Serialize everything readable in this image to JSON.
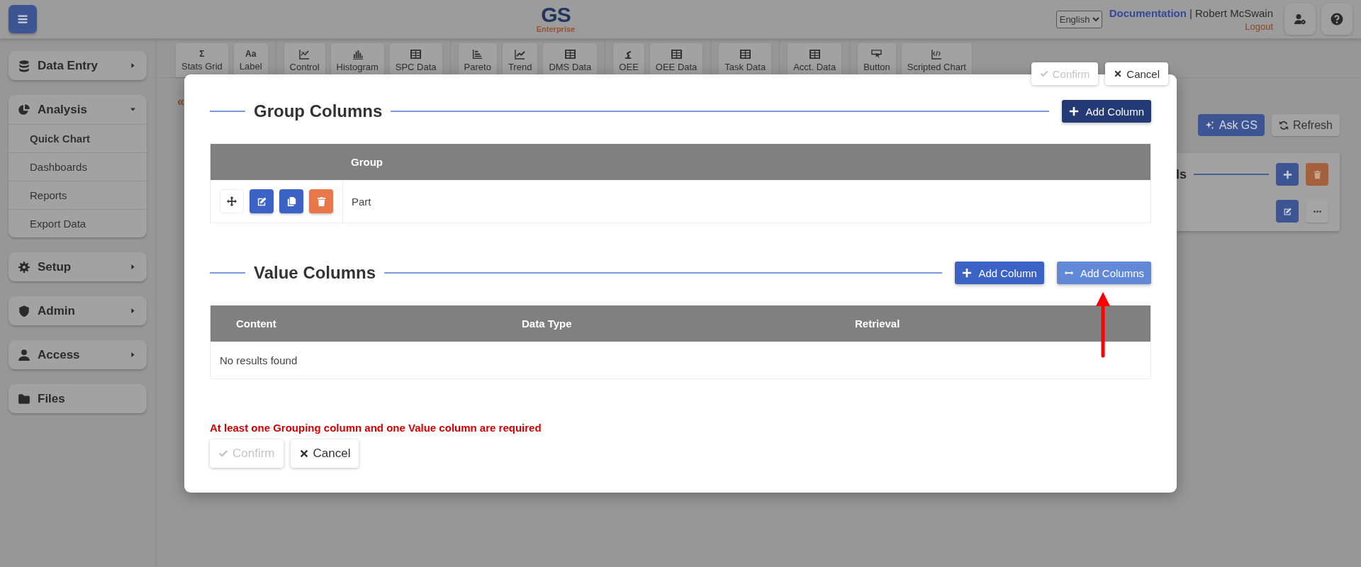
{
  "header": {
    "logo": {
      "title": "GS",
      "subtitle": "Enterprise"
    },
    "language": "English",
    "documentation_link": "Documentation",
    "user_name": "| Robert McSwain",
    "logout_link": "Logout"
  },
  "sidebar": [
    {
      "label": "Data Entry",
      "expanded": false
    },
    {
      "label": "Analysis",
      "expanded": true,
      "children": [
        {
          "label": "Quick Chart",
          "selected": true
        },
        {
          "label": "Dashboards",
          "selected": false
        },
        {
          "label": "Reports",
          "selected": false
        },
        {
          "label": "Export Data",
          "selected": false
        }
      ]
    },
    {
      "label": "Setup",
      "expanded": false
    },
    {
      "label": "Admin",
      "expanded": false
    },
    {
      "label": "Access",
      "expanded": false
    },
    {
      "label": "Files"
    }
  ],
  "toolbar": [
    [
      {
        "label": "Stats Grid",
        "glyph": "Σ"
      },
      {
        "label": "Label",
        "glyph": "Aa"
      }
    ],
    [
      {
        "label": "Control"
      },
      {
        "label": "Histogram"
      },
      {
        "label": "SPC Data"
      }
    ],
    [
      {
        "label": "Pareto"
      },
      {
        "label": "Trend"
      },
      {
        "label": "DMS Data"
      }
    ],
    [
      {
        "label": "OEE"
      },
      {
        "label": "OEE Data"
      }
    ],
    [
      {
        "label": "Task Data"
      }
    ],
    [
      {
        "label": "Acct. Data"
      }
    ],
    [
      {
        "label": "Button"
      },
      {
        "label": "Scripted Chart"
      }
    ]
  ],
  "page": {
    "back_link": "«",
    "ask_button": "Ask GS",
    "refresh_button": "Refresh",
    "panel": {
      "heading": "ls"
    }
  },
  "dialog": {
    "top_actions": [
      {
        "label": "Confirm",
        "disabled": true
      },
      {
        "label": "Cancel",
        "disabled": false
      }
    ],
    "sections": [
      {
        "title": "Group Columns",
        "buttons": [
          {
            "label": "Add Column",
            "kind": "dark"
          }
        ],
        "table": {
          "kind": "actions",
          "columns": [
            "Group"
          ],
          "rows": [
            {
              "cells": [
                "Part"
              ]
            }
          ]
        }
      },
      {
        "title": "Value Columns",
        "buttons": [
          {
            "label": "Add Column",
            "kind": "primary"
          },
          {
            "label": "Add Columns",
            "kind": "light"
          }
        ],
        "table": {
          "kind": "plain",
          "columns": [
            "Content",
            "Data Type",
            "Retrieval"
          ],
          "empty_text": "No results found"
        }
      }
    ],
    "error": "At least one Grouping column and one Value column are required",
    "actions": [
      {
        "label": "Confirm",
        "disabled": true
      },
      {
        "label": "Cancel",
        "disabled": false
      }
    ]
  }
}
